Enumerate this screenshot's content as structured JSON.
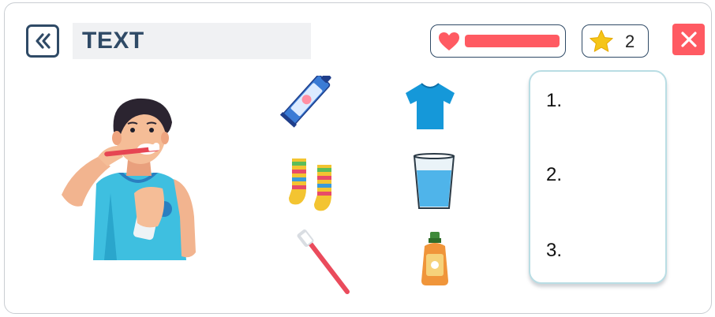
{
  "header": {
    "title": "TEXT",
    "back_icon": "double-chevron-left-icon",
    "health": {
      "icon": "heart-icon",
      "level": 1.0
    },
    "stars": {
      "icon": "star-icon",
      "count": "2"
    },
    "close_icon": "close-icon"
  },
  "scene": {
    "character": "boy-brushing-teeth"
  },
  "items": [
    {
      "name": "toothpaste",
      "icon": "toothpaste-icon"
    },
    {
      "name": "t-shirt",
      "icon": "tshirt-icon"
    },
    {
      "name": "socks",
      "icon": "socks-icon"
    },
    {
      "name": "glass-of-water",
      "icon": "water-glass-icon"
    },
    {
      "name": "toothbrush",
      "icon": "toothbrush-icon"
    },
    {
      "name": "bottle",
      "icon": "bottle-icon"
    }
  ],
  "answers": {
    "slots": [
      "1.",
      "2.",
      "3."
    ]
  },
  "colors": {
    "accent": "#2f4a66",
    "health": "#ff5a62",
    "star": "#f5c518",
    "close": "#ff5a62",
    "card_border": "#b9dde4"
  }
}
